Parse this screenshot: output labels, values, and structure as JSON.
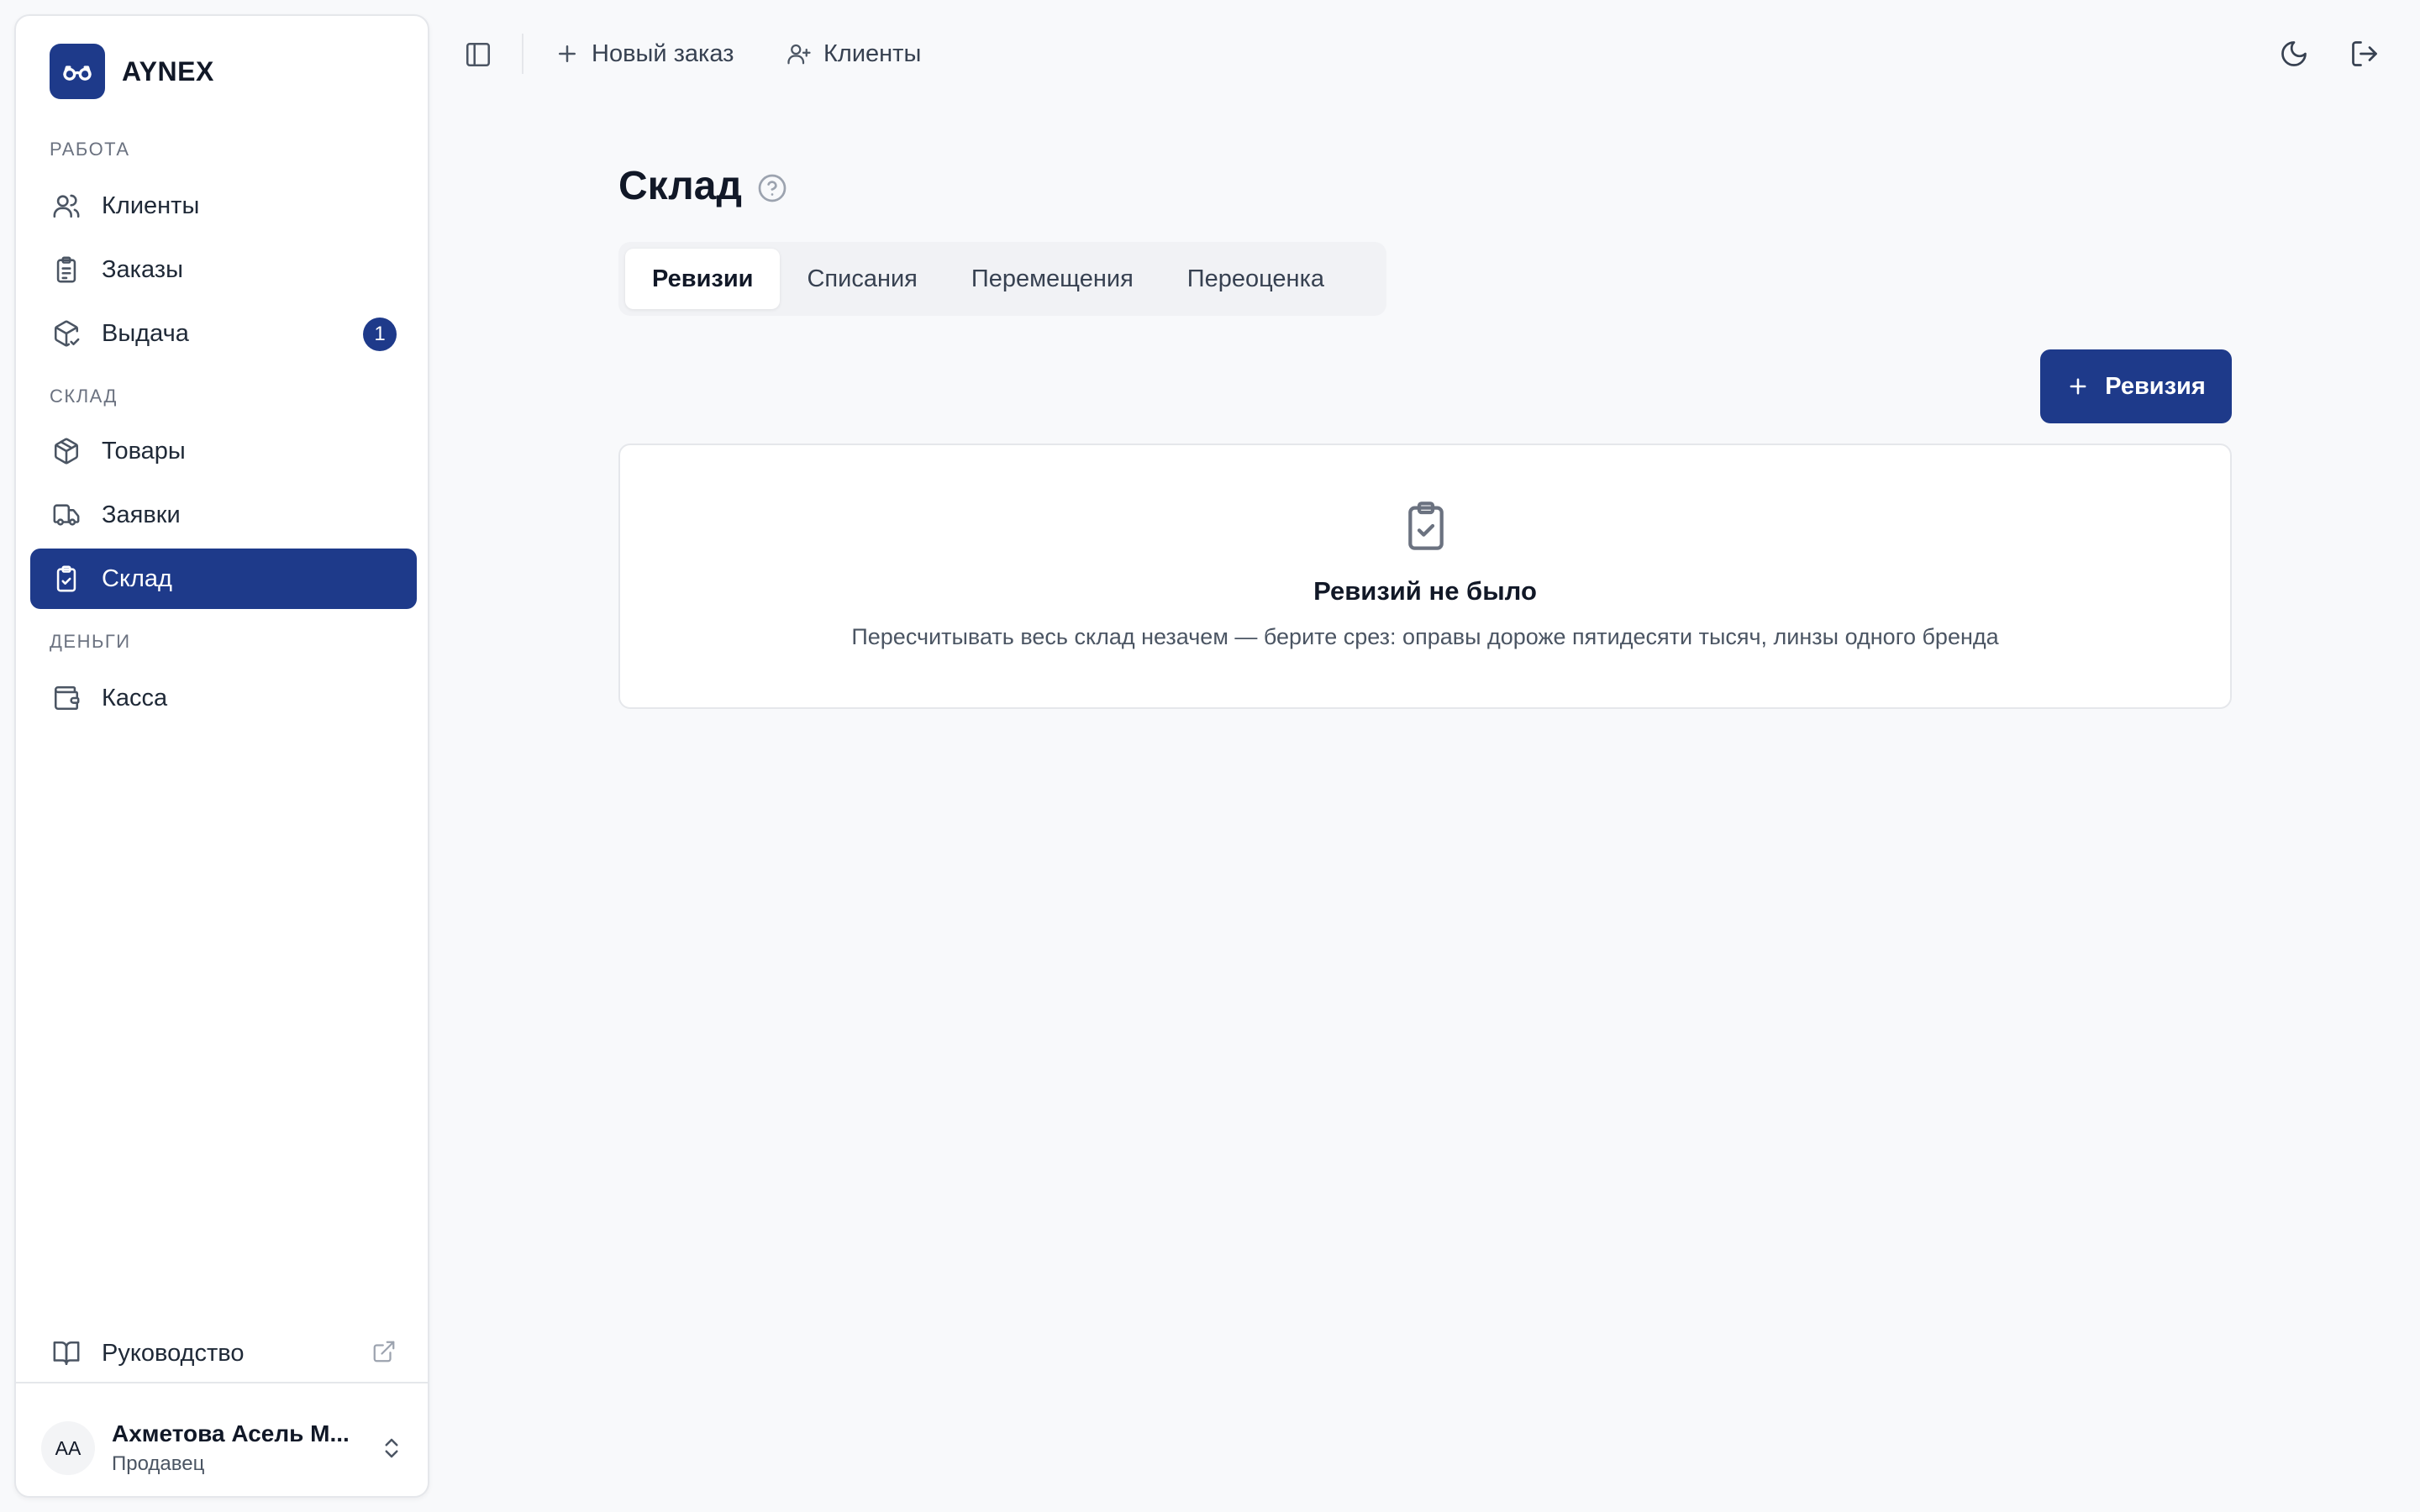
{
  "colors": {
    "accent": "#1e3a8a",
    "background": "#f8f9fb",
    "sidebar_bg": "#ffffff"
  },
  "brand": {
    "name": "AYNEX",
    "logo_icon": "glasses-icon"
  },
  "sidebar": {
    "sections": [
      {
        "label": "РАБОТА",
        "items": [
          {
            "label": "Клиенты",
            "icon": "users-icon"
          },
          {
            "label": "Заказы",
            "icon": "clipboard-list-icon"
          },
          {
            "label": "Выдача",
            "icon": "package-check-icon",
            "badge": "1"
          }
        ]
      },
      {
        "label": "СКЛАД",
        "items": [
          {
            "label": "Товары",
            "icon": "package-icon"
          },
          {
            "label": "Заявки",
            "icon": "truck-icon"
          },
          {
            "label": "Склад",
            "icon": "clipboard-check-icon",
            "active": true
          }
        ]
      },
      {
        "label": "ДЕНЬГИ",
        "items": [
          {
            "label": "Касса",
            "icon": "wallet-icon"
          }
        ]
      }
    ],
    "guide": {
      "label": "Руководство",
      "icon": "book-open-icon",
      "external_icon": "external-link-icon"
    }
  },
  "user": {
    "initials": "АА",
    "name": "Ахметова Асель М...",
    "role": "Продавец"
  },
  "topbar": {
    "toggle_icon": "sidebar-toggle-icon",
    "new_order_label": "Новый заказ",
    "clients_label": "Клиенты",
    "theme_icon": "moon-icon",
    "logout_icon": "logout-icon"
  },
  "page": {
    "title": "Склад",
    "tabs": [
      {
        "label": "Ревизии",
        "active": true
      },
      {
        "label": "Списания"
      },
      {
        "label": "Перемещения"
      },
      {
        "label": "Переоценка"
      }
    ],
    "add_button_label": "Ревизия",
    "empty_state": {
      "icon": "clipboard-check-icon",
      "title": "Ревизий не было",
      "description": "Пересчитывать весь склад незачем — берите срез: оправы дороже пятидесяти тысяч, линзы одного бренда"
    }
  }
}
